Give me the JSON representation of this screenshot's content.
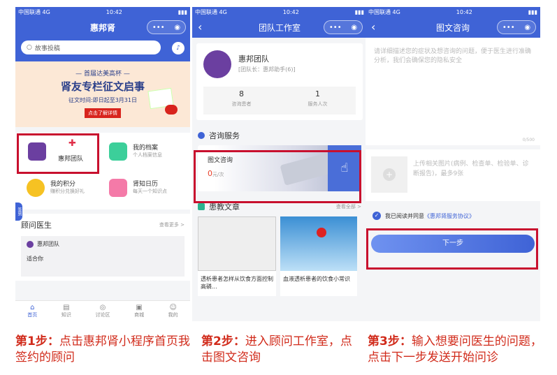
{
  "status": {
    "carrier": "中国联通",
    "network": "4G",
    "time": "10:42"
  },
  "panel1": {
    "title": "惠邦肾",
    "search_placeholder": "故事投稿",
    "banner": {
      "line1": "— 首届达美高杯 —",
      "line2": "肾友专栏征文启事",
      "line3": "征文时间:即日起至3月31日",
      "button": "点击了解详情"
    },
    "grid": [
      {
        "label": "惠邦团队",
        "sub": ""
      },
      {
        "label": "我的档案",
        "sub": "个人档案信息"
      },
      {
        "label": "我的积分",
        "sub": "赚积分兑换好礼"
      },
      {
        "label": "肾知日历",
        "sub": "每天一个知识点"
      }
    ],
    "side_badge": "签到",
    "advisor": {
      "title": "顾问医生",
      "more": "查看更多 >",
      "team": "惠邦团队",
      "desc": "适合你"
    },
    "tabs": [
      "首页",
      "知识",
      "讨论区",
      "商城",
      "我的"
    ]
  },
  "panel2": {
    "title": "团队工作室",
    "team_name": "惠邦团队",
    "team_leader": "[团队长：惠邦助手(6)]",
    "stats": [
      {
        "value": "8",
        "label": "咨询患者"
      },
      {
        "value": "1",
        "label": "服务人次"
      }
    ],
    "consult_section": "咨询服务",
    "consult": {
      "name": "图文咨询",
      "price": "0",
      "unit": "元/次"
    },
    "articles_section": "患教文章",
    "articles_more": "查看全部 >",
    "articles": [
      {
        "title": "透析患者怎样从饮食方面控制高磷..."
      },
      {
        "title": "血液透析患者的饮食小常识"
      }
    ]
  },
  "panel3": {
    "title": "图文咨询",
    "placeholder": "请详细描述您的症状及想咨询的问题，便于医生进行准确分析，我们会确保您的隐私安全",
    "counter": "0/500",
    "upload_text": "上传相关图片(病例、检查单、检验单、诊断报告)，最多9张",
    "agree_prefix": "我已阅读并同意",
    "agree_link": "《惠邦肾服务协议》",
    "next_button": "下一步"
  },
  "captions": [
    {
      "step": "第1步：",
      "text": "点击惠邦肾小程序首页我签约的顾问"
    },
    {
      "step": "第2步：",
      "text": "进入顾问工作室，点击图文咨询"
    },
    {
      "step": "第3步：",
      "text": "输入想要问医生的问题，点击下一步发送开始问诊"
    }
  ],
  "colors": {
    "primary": "#3f63d6",
    "highlight": "#c8102e",
    "caption": "#d12b1b",
    "team": "#6b3fa0"
  }
}
